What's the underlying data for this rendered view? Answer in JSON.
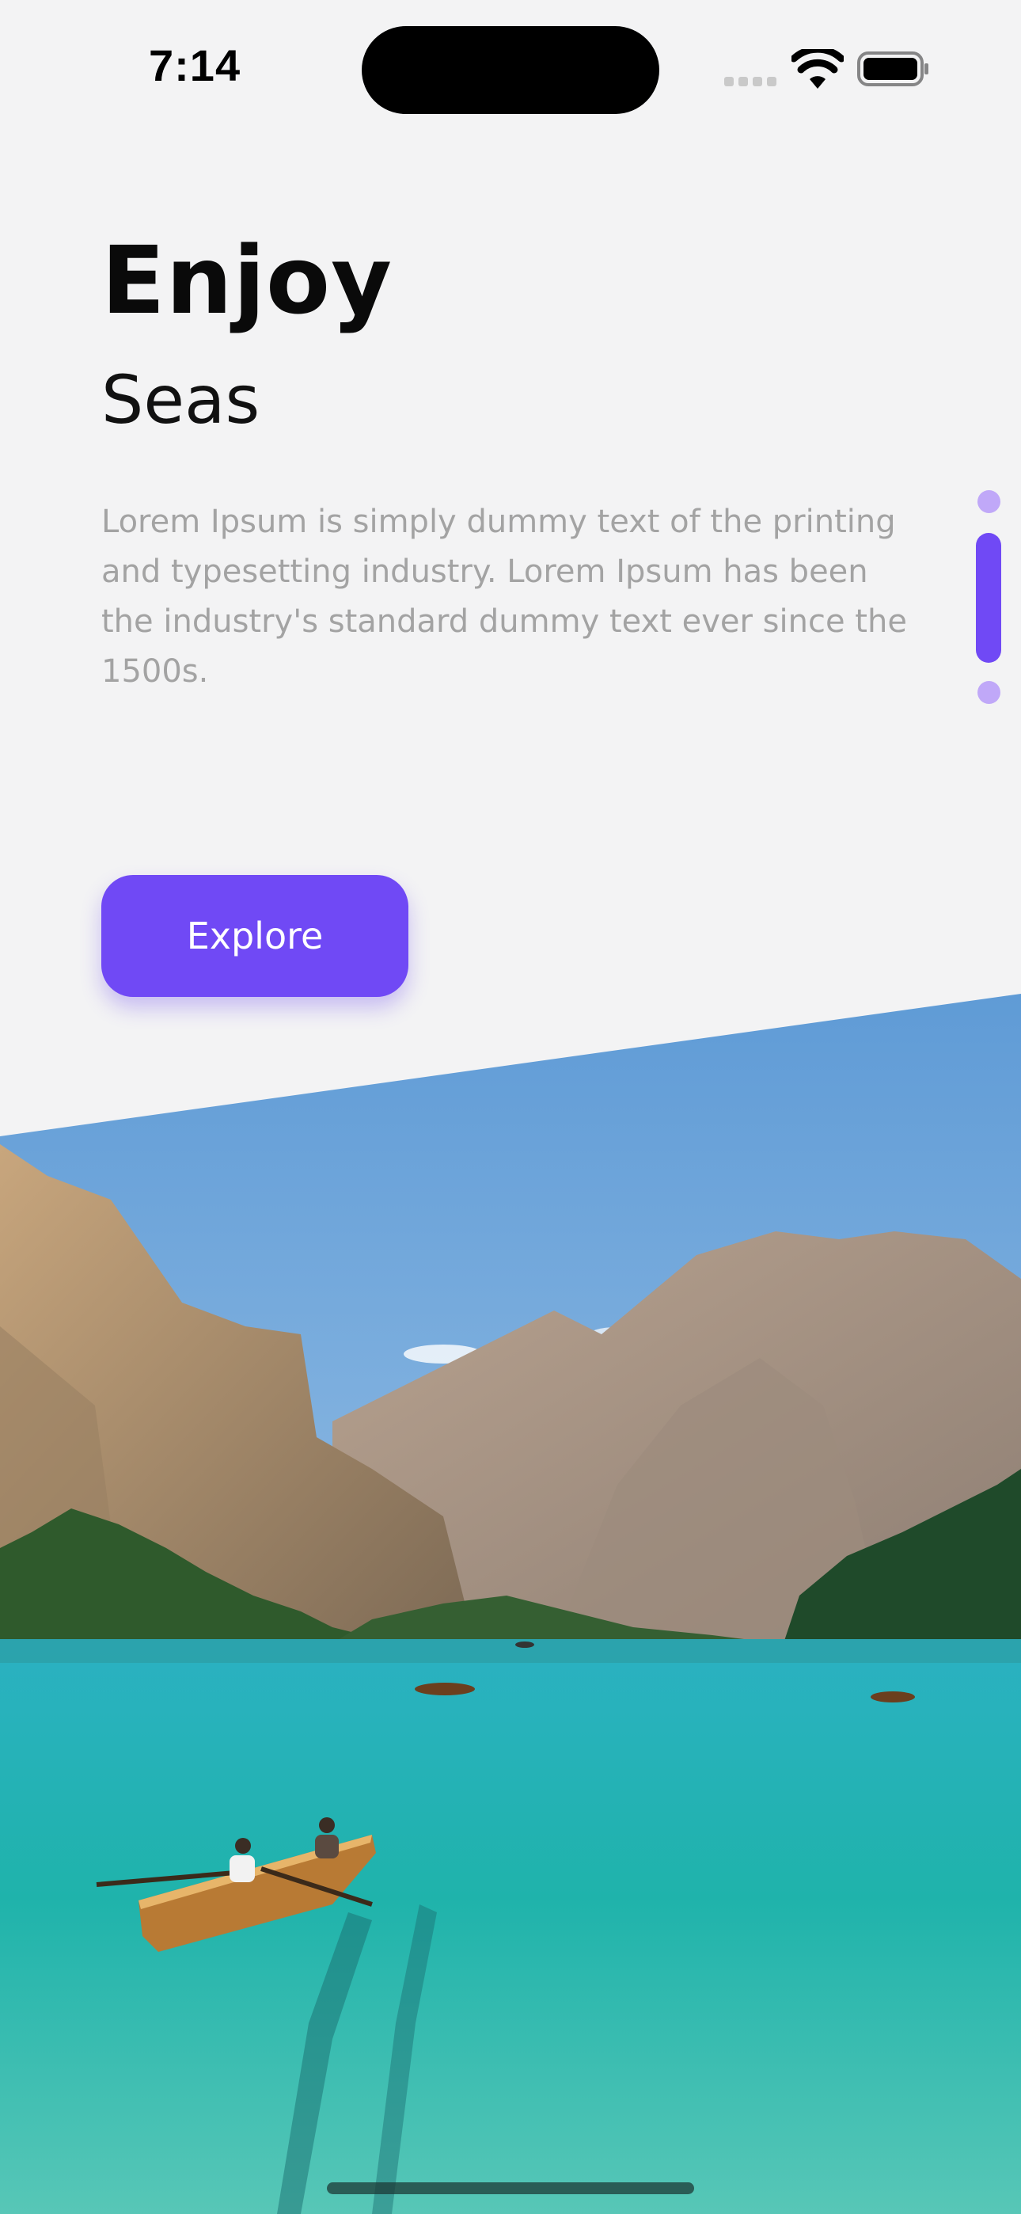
{
  "status_bar": {
    "time": "7:14",
    "icons": [
      "cellular-signal-icon",
      "wifi-icon",
      "battery-icon"
    ]
  },
  "hero": {
    "title": "Enjoy",
    "subtitle": "Seas",
    "description": "Lorem Ipsum is simply dummy text of the printing and typesetting industry. Lorem Ipsum has been the industry's standard dummy text ever since the 1500s."
  },
  "pager": {
    "pages": 3,
    "active_index": 1
  },
  "cta": {
    "label": "Explore"
  },
  "image": {
    "subject": "mountain lake with rowing boats"
  },
  "colors": {
    "accent": "#7049f5",
    "indicator_inactive": "#c0a8f8",
    "background": "#f3f3f4",
    "description_text": "#a3a3a3"
  }
}
